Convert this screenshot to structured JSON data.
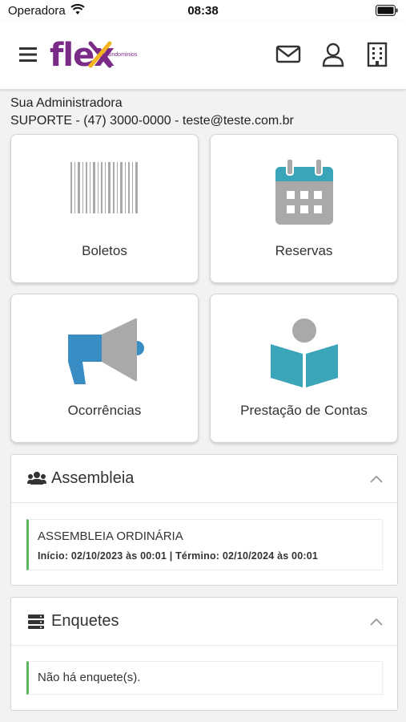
{
  "status_bar": {
    "carrier": "Operadora",
    "time": "08:38"
  },
  "header": {
    "logo_text": "flex",
    "logo_sub": "condominios",
    "menu_icon": "hamburger-menu-icon",
    "actions": [
      "mail-icon",
      "user-icon",
      "building-icon"
    ]
  },
  "admin": {
    "title": "Sua Administradora",
    "contact": "SUPORTE - (47) 3000-0000 - teste@teste.com.br"
  },
  "tiles": [
    {
      "label": "Boletos",
      "icon": "barcode-icon"
    },
    {
      "label": "Reservas",
      "icon": "calendar-icon"
    },
    {
      "label": "Ocorrências",
      "icon": "megaphone-icon"
    },
    {
      "label": "Prestação de Contas",
      "icon": "book-icon"
    }
  ],
  "assembleia": {
    "title": "Assembleia",
    "icon": "users-icon",
    "item_title": "ASSEMBLEIA ORDINÁRIA",
    "item_dates": "Início: 02/10/2023 às 00:01 | Término: 02/10/2024 às 00:01"
  },
  "enquetes": {
    "title": "Enquetes",
    "icon": "server-icon",
    "empty_text": "Não há enquete(s)."
  },
  "colors": {
    "brand_purple": "#7a2a87",
    "brand_yellow": "#f2b31d",
    "teal": "#3aa5b8",
    "blue": "#3a8cc4",
    "gray_icon": "#a9a9a9",
    "success_green": "#5cb85c"
  }
}
